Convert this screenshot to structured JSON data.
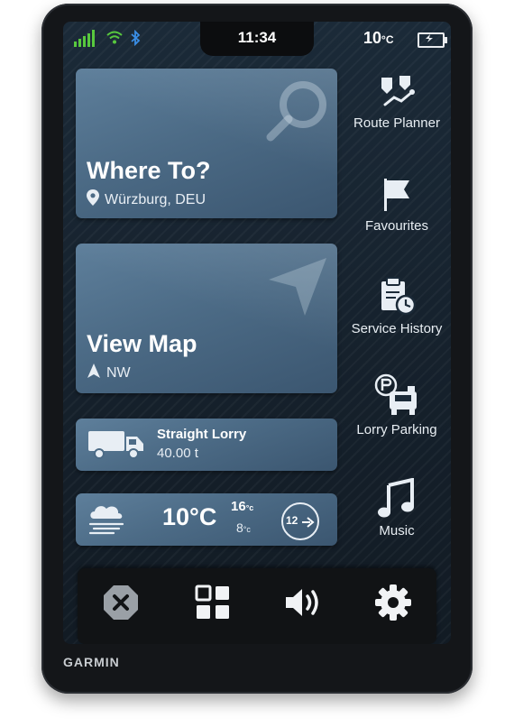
{
  "device": {
    "brand": "GARMIN"
  },
  "status_bar": {
    "time": "11:34",
    "temperature_value": "10",
    "temperature_unit": "°C",
    "icons": [
      "signal-icon",
      "wifi-icon",
      "bluetooth-icon",
      "battery-charging-icon"
    ]
  },
  "tiles": {
    "where_to": {
      "title": "Where To?",
      "location": "Würzburg, DEU",
      "icon": "search-icon"
    },
    "view_map": {
      "title": "View Map",
      "heading": "NW",
      "icon": "navigation-arrow-icon"
    },
    "vehicle": {
      "name": "Straight Lorry",
      "weight": "40.00 t",
      "icon": "lorry-icon"
    },
    "weather": {
      "temp": "10°C",
      "high": "16",
      "low": "8",
      "unit_small": "°c",
      "speed_badge": "12"
    }
  },
  "sidebar": {
    "items": [
      {
        "label": "Route Planner",
        "icon": "route-planner-icon"
      },
      {
        "label": "Favourites",
        "icon": "flag-icon"
      },
      {
        "label": "Service History",
        "icon": "service-history-icon"
      },
      {
        "label": "Lorry Parking",
        "icon": "lorry-parking-icon"
      },
      {
        "label": "Music",
        "icon": "music-icon"
      }
    ]
  },
  "bottom_bar": {
    "icons": [
      "close-icon",
      "apps-grid-icon",
      "volume-icon",
      "settings-gear-icon"
    ]
  },
  "colors": {
    "tile": "#4c6b86",
    "accent_blue": "#3a8ee6",
    "signal_green": "#58c93e"
  }
}
